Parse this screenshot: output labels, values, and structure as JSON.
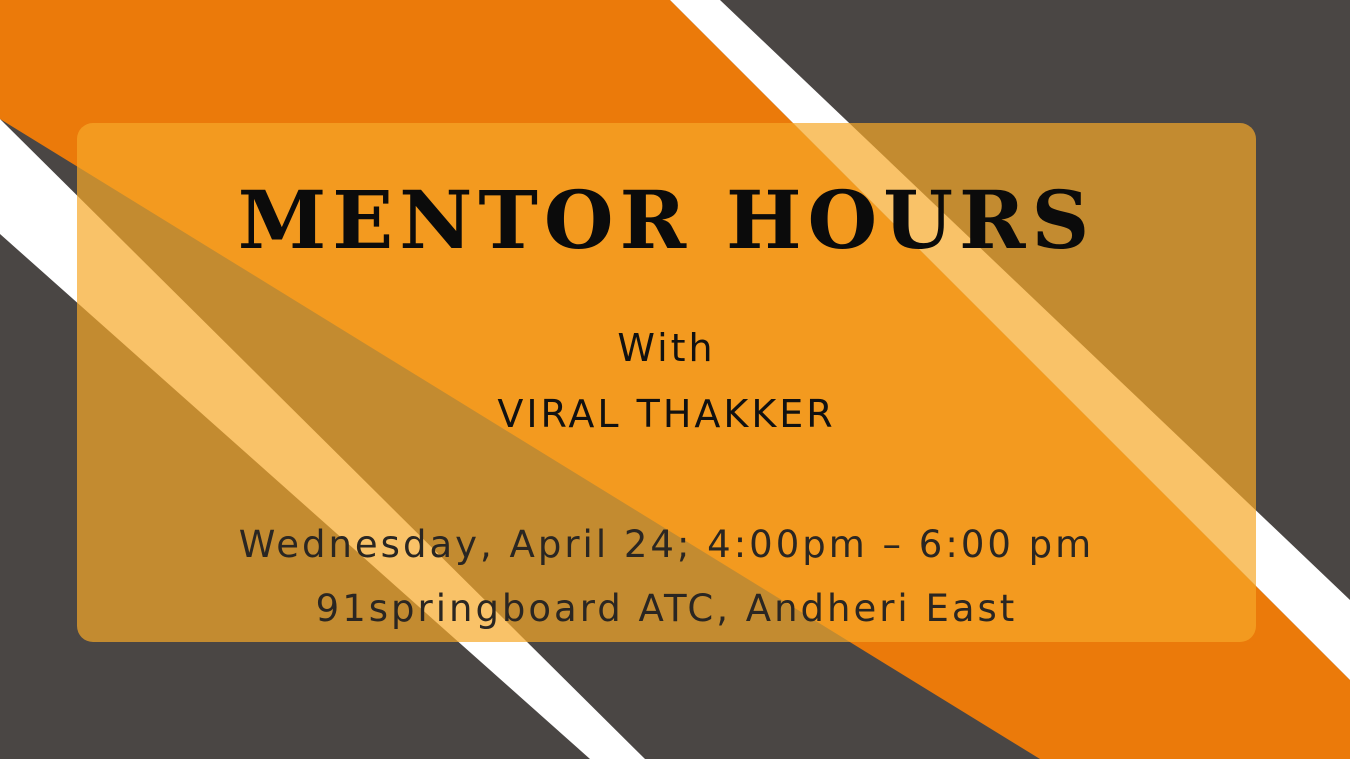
{
  "colors": {
    "dark_background": "#4a4644",
    "orange_stripe": "#eb7a0a",
    "white_stripe": "#ffffff",
    "card_overlay": "#f6a828"
  },
  "poster": {
    "title": "MENTOR HOURS",
    "with_label": "With",
    "mentor_name": "VIRAL THAKKER",
    "date_time": "Wednesday, April 24; 4:00pm – 6:00 pm",
    "venue": "91springboard ATC, Andheri East"
  }
}
